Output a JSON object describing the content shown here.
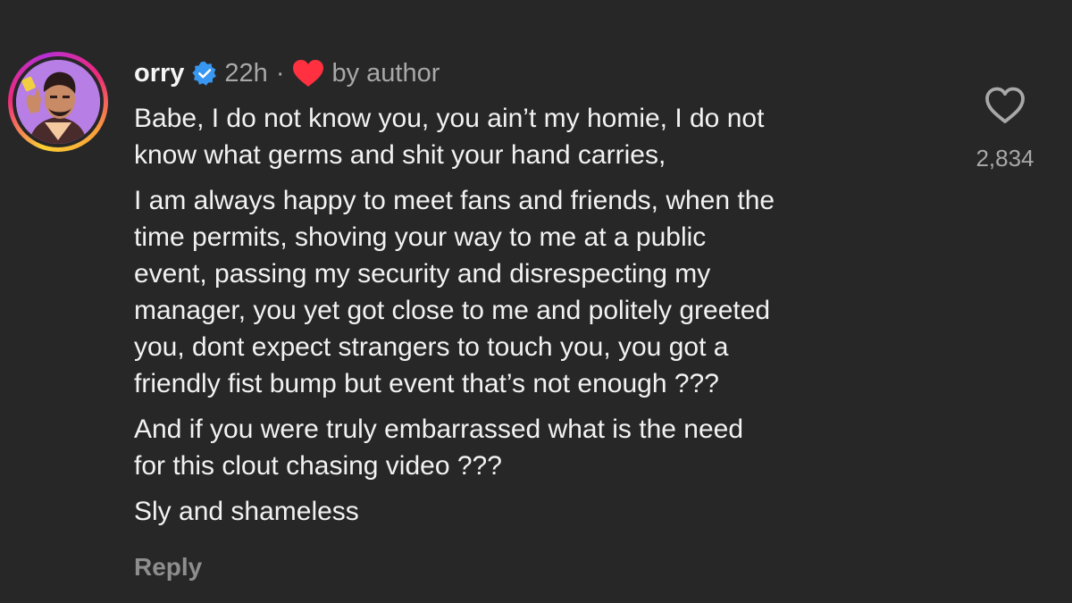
{
  "comment": {
    "username": "orry",
    "verified": true,
    "time": "22h",
    "separator": "·",
    "liked_by_author_label": "by author",
    "paragraphs": [
      [
        "Babe, I do not know you, you ain’t my homie, I do not",
        "know what germs and shit your hand carries,"
      ],
      [
        "I am always happy to meet fans and friends, when the",
        "time permits, shoving your way to me at a public",
        "event, passing my security and disrespecting my",
        "manager, you yet got close to me and politely greeted",
        "you, dont expect strangers to touch you, you got a",
        "friendly fist bump but event that’s not enough ???"
      ],
      [
        "And if you were truly embarrassed what is the need",
        "for this clout chasing video ???"
      ],
      [
        "Sly and shameless"
      ]
    ],
    "reply_label": "Reply",
    "like_count": "2,834"
  },
  "icons": {
    "verified": "verified-badge-icon",
    "author_heart": "heart-filled-icon",
    "like": "heart-outline-icon",
    "avatar": "profile-avatar"
  },
  "colors": {
    "background": "#272727",
    "verified_blue": "#3897f0",
    "heart_red": "#ff3040",
    "secondary_text": "#a8a8a8"
  }
}
